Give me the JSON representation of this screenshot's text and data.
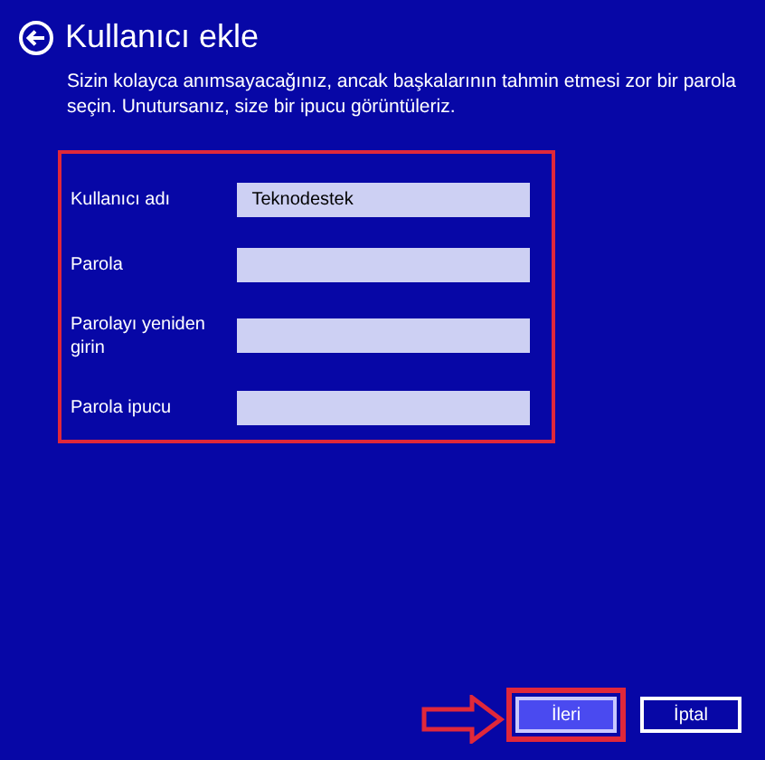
{
  "header": {
    "title": "Kullanıcı ekle",
    "description": "Sizin kolayca anımsayacağınız, ancak başkalarının tahmin etmesi zor bir parola seçin. Unutursanız, size bir ipucu görüntüleriz."
  },
  "fields": [
    {
      "label": "Kullanıcı adı",
      "value": "Teknodestek"
    },
    {
      "label": "Parola"
    },
    {
      "label": "Parolayı yeniden girin"
    },
    {
      "label": "Parola ipucu"
    }
  ],
  "buttons": [
    {
      "label": "İleri",
      "kind": "primary"
    },
    {
      "label": "İptal",
      "kind": "secondary"
    }
  ]
}
